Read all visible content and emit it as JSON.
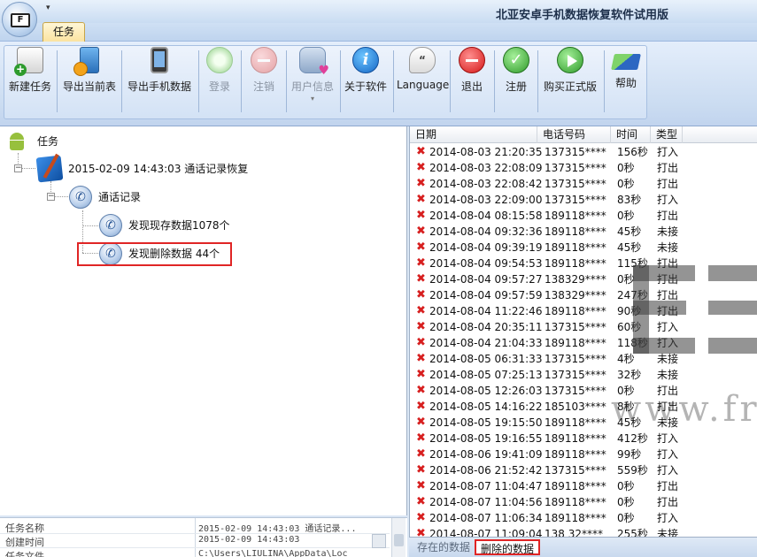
{
  "app": {
    "title": "北亚安卓手机数据恢复软件试用版",
    "orb_label": "F",
    "qat_icon": "dropdown-arrow",
    "tab_label": "任务"
  },
  "toolbar": [
    {
      "id": "new-task",
      "label": "新建任务",
      "icon": "new-task-icon",
      "enabled": true
    },
    {
      "id": "export-current",
      "label": "导出当前表",
      "icon": "export-table-icon",
      "enabled": true
    },
    {
      "id": "export-phone",
      "label": "导出手机数据",
      "icon": "phone-icon",
      "enabled": true
    },
    {
      "id": "login",
      "label": "登录",
      "icon": "login-icon",
      "enabled": false
    },
    {
      "id": "logout",
      "label": "注销",
      "icon": "logout-icon",
      "enabled": false
    },
    {
      "id": "user-info",
      "label": "用户信息",
      "icon": "user-info-icon",
      "enabled": false
    },
    {
      "id": "about",
      "label": "关于软件",
      "icon": "info-icon",
      "enabled": true
    },
    {
      "id": "language",
      "label": "Language",
      "icon": "language-icon",
      "enabled": true
    },
    {
      "id": "quit",
      "label": "退出",
      "icon": "quit-icon",
      "enabled": true
    },
    {
      "id": "register",
      "label": "注册",
      "icon": "register-check-icon",
      "enabled": true
    },
    {
      "id": "buy",
      "label": "购买正式版",
      "icon": "buy-play-icon",
      "enabled": true
    },
    {
      "id": "help",
      "label": "帮助",
      "icon": "help-icon",
      "enabled": true
    }
  ],
  "tree": {
    "root": "任务",
    "task": "2015-02-09 14:43:03 通话记录恢复",
    "category": "通话记录",
    "existing": "发现现存数据1078个",
    "deleted": "发现删除数据 44个"
  },
  "properties": [
    {
      "name": "任务名称",
      "value": "2015-02-09 14:43:03 通话记录..."
    },
    {
      "name": "创建时间",
      "value": "2015-02-09 14:43:03"
    },
    {
      "name": "任务文件",
      "value": "C:\\Users\\LIULINA\\AppData\\Loc"
    }
  ],
  "list": {
    "columns": [
      "日期",
      "电话号码",
      "时间",
      "类型"
    ],
    "rows": [
      [
        "2014-08-03  21:20:35",
        "137315****",
        "156秒",
        "打入"
      ],
      [
        "2014-08-03  22:08:09",
        "137315****",
        "0秒",
        "打出"
      ],
      [
        "2014-08-03  22:08:42",
        "137315****",
        "0秒",
        "打出"
      ],
      [
        "2014-08-03  22:09:00",
        "137315****",
        "83秒",
        "打入"
      ],
      [
        "2014-08-04  08:15:58",
        "189118****",
        "0秒",
        "打出"
      ],
      [
        "2014-08-04  09:32:36",
        "189118****",
        "45秒",
        "未接"
      ],
      [
        "2014-08-04  09:39:19",
        "189118****",
        "45秒",
        "未接"
      ],
      [
        "2014-08-04  09:54:53",
        "189118****",
        "115秒",
        "打出"
      ],
      [
        "2014-08-04  09:57:27",
        "138329****",
        "0秒",
        "打出"
      ],
      [
        "2014-08-04  09:57:59",
        "138329****",
        "247秒",
        "打出"
      ],
      [
        "2014-08-04  11:22:46",
        "189118****",
        "90秒",
        "打出"
      ],
      [
        "2014-08-04  20:35:11",
        "137315****",
        "60秒",
        "打入"
      ],
      [
        "2014-08-04  21:04:33",
        "189118****",
        "118秒",
        "打入"
      ],
      [
        "2014-08-05  06:31:33",
        "137315****",
        "4秒",
        "未接"
      ],
      [
        "2014-08-05  07:25:13",
        "137315****",
        "32秒",
        "未接"
      ],
      [
        "2014-08-05  12:26:03",
        "137315****",
        "0秒",
        "打出"
      ],
      [
        "2014-08-05  14:16:22",
        "185103****",
        "8秒",
        "打出"
      ],
      [
        "2014-08-05  19:15:50",
        "189118****",
        "45秒",
        "未接"
      ],
      [
        "2014-08-05  19:16:55",
        "189118****",
        "412秒",
        "打入"
      ],
      [
        "2014-08-06  19:41:09",
        "189118****",
        "99秒",
        "打入"
      ],
      [
        "2014-08-06  21:52:42",
        "137315****",
        "559秒",
        "打入"
      ],
      [
        "2014-08-07  11:04:47",
        "189118****",
        "0秒",
        "打出"
      ],
      [
        "2014-08-07  11:04:56",
        "189118****",
        "0秒",
        "打出"
      ],
      [
        "2014-08-07  11:06:34",
        "189118****",
        "0秒",
        "打入"
      ],
      [
        "2014-08-07  11:09:04",
        "138 32****",
        "255秒",
        "未接"
      ]
    ]
  },
  "bottom_tabs": {
    "existing": "存在的数据",
    "deleted": "删除的数据"
  },
  "watermark": "www.fro",
  "colors": {
    "accent_red": "#e02525",
    "ribbon_blue": "#cbdcf1"
  }
}
